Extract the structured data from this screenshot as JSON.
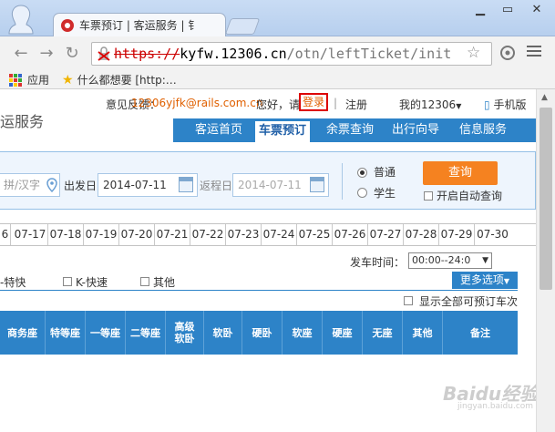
{
  "browser": {
    "tab_title": "车票预订 | 客运服务 | 钅",
    "url_scheme": "https://",
    "url_host": "kyfw.12306.cn",
    "url_path": "/otn/leftTicket/init",
    "bookmarks": [
      {
        "label": "应用",
        "icon": "apps-grid-icon"
      },
      {
        "label": "什么都想要 [http:…",
        "icon": "star-icon"
      }
    ]
  },
  "header": {
    "brand_partial": "运服务",
    "feedback_label": "意见反馈：",
    "feedback_email": "12306yjfk@rails.com.cn",
    "greeting": "您好，请",
    "login": "登录",
    "separator": "|",
    "register": "注册",
    "my_account": "我的12306",
    "mobile": "手机版"
  },
  "nav": {
    "items": [
      "客运首页",
      "车票预订",
      "余票查询",
      "出行向导",
      "信息服务"
    ],
    "active": "车票预订"
  },
  "search": {
    "to_placeholder": "拼/汉字",
    "depart_label": "出发日",
    "depart_value": "2014-07-11",
    "return_label": "返程日",
    "return_value": "2014-07-11",
    "radio_normal": "普通",
    "radio_student": "学生",
    "query_button": "查询",
    "auto_query": "开启自动查询"
  },
  "dates": [
    "6",
    "07-17",
    "07-18",
    "07-19",
    "07-20",
    "07-21",
    "07-22",
    "07-23",
    "07-24",
    "07-25",
    "07-26",
    "07-27",
    "07-28",
    "07-29",
    "07-30"
  ],
  "filters": {
    "depart_time_label": "发车时间：",
    "depart_time_value": "00:00--24:0",
    "type_fast_partial": "-特快",
    "type_k": "K-快速",
    "type_other": "其他",
    "more_options": "更多选项",
    "show_all": "显示全部可预订车次"
  },
  "table": {
    "headers": [
      "商务座",
      "特等座",
      "一等座",
      "二等座",
      "高级软卧",
      "软卧",
      "硬卧",
      "软座",
      "硬座",
      "无座",
      "其他",
      "备注"
    ]
  },
  "watermark": {
    "text": "Baidu经验",
    "sub": "jingyan.baidu.com"
  },
  "colors": {
    "nav_blue": "#2d83c8",
    "query_orange": "#f58220",
    "highlight_red": "#dd0000"
  }
}
